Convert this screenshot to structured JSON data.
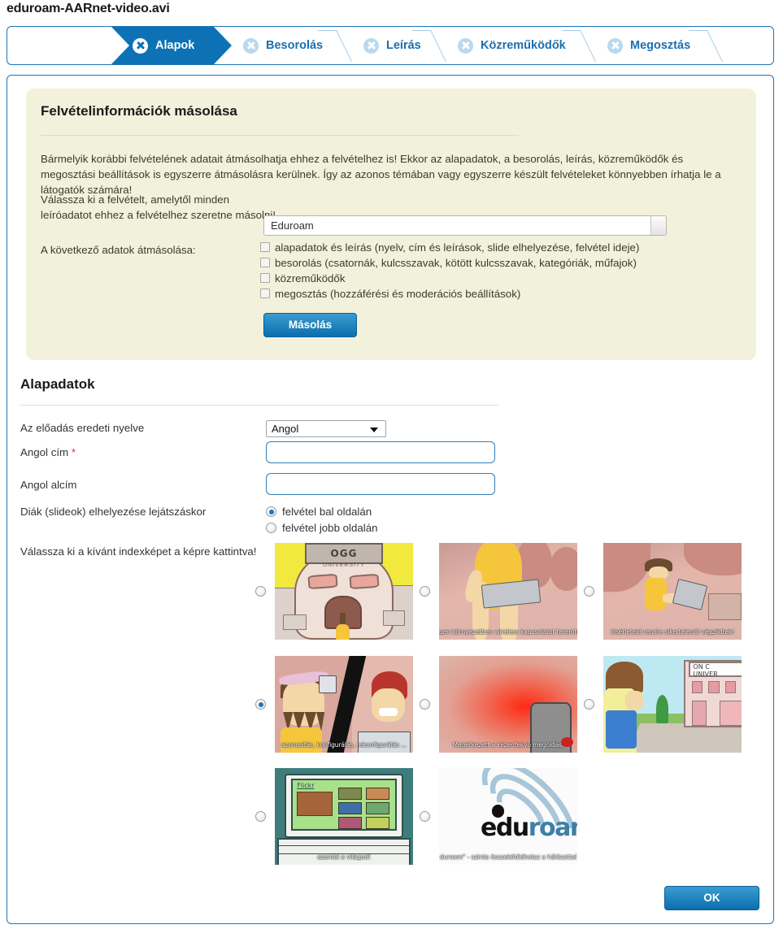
{
  "page": {
    "title": "eduroam-AARnet-video.avi"
  },
  "wizard": {
    "steps": [
      {
        "label": "Alapok",
        "active": true
      },
      {
        "label": "Besorolás",
        "active": false
      },
      {
        "label": "Leírás",
        "active": false
      },
      {
        "label": "Közreműködők",
        "active": false
      },
      {
        "label": "Megosztás",
        "active": false
      }
    ]
  },
  "copy_panel": {
    "title": "Felvételinformációk másolása",
    "paragraph": "Bármelyik korábbi felvételének adatait átmásolhatja ehhez a felvételhez is! Ekkor az alapadatok, a besorolás, leírás, közreműködők és megosztási beállítások is egyszerre átmásolásra kerülnek. Így az azonos témában vagy egyszerre készült felvételeket könnyebben írhatja le a látogatók számára!",
    "prompt_line1": "Válassza ki a felvételt, amelytől minden",
    "prompt_line2": "leíróadatot ehhez a felvételhez szeretne másolni!",
    "recording_select": {
      "value": "Eduroam"
    },
    "fields_label": "A következő adatok átmásolása:",
    "checkboxes": [
      {
        "label": "alapadatok és leírás (nyelv, cím és leírások, slide elhelyezése, felvétel ideje)",
        "checked": false
      },
      {
        "label": "besorolás (csatornák, kulcsszavak, kötött kulcsszavak, kategóriák, műfajok)",
        "checked": false
      },
      {
        "label": "közreműködők",
        "checked": false
      },
      {
        "label": "megosztás (hozzáférési és moderációs beállítások)",
        "checked": false
      }
    ],
    "copy_button": "Másolás"
  },
  "basic_data": {
    "section_title": "Alapadatok",
    "language_label": "Az előadás eredeti nyelve",
    "language_value": "Angol",
    "title_label": "Angol cím",
    "title_required_mark": "*",
    "title_value": "",
    "subtitle_label": "Angol alcím",
    "subtitle_value": "",
    "slide_position_label": "Diák (slideok) elhelyezése lejátszáskor",
    "slide_position_options": [
      {
        "label": "felvétel bal oldalán",
        "selected": true
      },
      {
        "label": "felvétel jobb oldalán",
        "selected": false
      }
    ],
    "index_image_label": "Válassza ki a kívánt indexképet a képre kattintva!",
    "index_images": [
      {
        "caption": "",
        "selected": false,
        "art": "ogg-university"
      },
      {
        "caption": "gen környezetben wireless kapcsolatot teremte",
        "selected": false,
        "art": "caveman-laptop"
      },
      {
        "caption": "kísérleteid rendre sikertelenül végződtek!",
        "selected": false,
        "art": "caveman-sitting"
      },
      {
        "caption": "azonosítás, konfigurálás, rekonfigurálás ...",
        "selected": true,
        "art": "two-cavemen"
      },
      {
        "caption": "Megérkezett a kézenfekvő megoldás,",
        "selected": false,
        "art": "red-glow"
      },
      {
        "caption": "",
        "selected": false,
        "art": "student-campus"
      },
      {
        "caption": "ezentúl a világod!",
        "selected": false,
        "art": "flickr-laptop"
      },
      {
        "caption": "duroam\" - szinte összekötődhetsz a hálózattal",
        "selected": false,
        "art": "eduroam-logo"
      }
    ]
  },
  "footer": {
    "ok_button": "OK"
  },
  "colors": {
    "accent_blue": "#0c72b5",
    "panel_yellow": "#f2f2dc",
    "required_red": "#e03030",
    "input_border_blue": "#2f80b8"
  }
}
